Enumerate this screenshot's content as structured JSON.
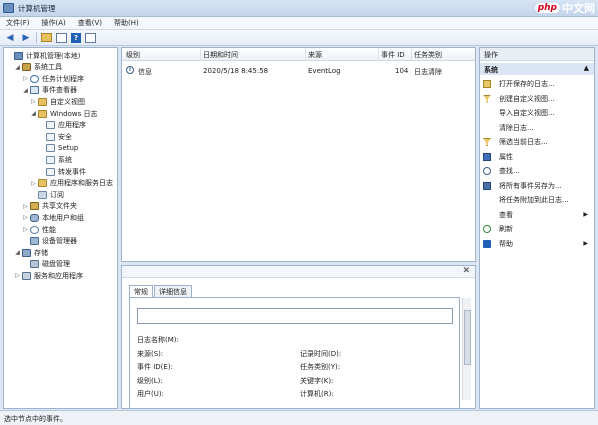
{
  "window": {
    "title": "计算机管理",
    "watermark_logo": "php",
    "watermark_text": "中文网"
  },
  "menu": [
    "文件(F)",
    "操作(A)",
    "查看(V)",
    "帮助(H)"
  ],
  "tree": [
    {
      "label": "计算机管理(本地)",
      "twisty": "",
      "indent": 0,
      "icon": "computer-icon"
    },
    {
      "label": "系统工具",
      "twisty": "◢",
      "indent": 1,
      "icon": "tools-icon"
    },
    {
      "label": "任务计划程序",
      "twisty": "▷",
      "indent": 2,
      "icon": "clock-icon"
    },
    {
      "label": "事件查看器",
      "twisty": "◢",
      "indent": 2,
      "icon": "event-viewer-icon"
    },
    {
      "label": "自定义视图",
      "twisty": "▷",
      "indent": 3,
      "icon": "folder-icon"
    },
    {
      "label": "Windows 日志",
      "twisty": "◢",
      "indent": 3,
      "icon": "folder-icon"
    },
    {
      "label": "应用程序",
      "twisty": "",
      "indent": 4,
      "icon": "log-icon"
    },
    {
      "label": "安全",
      "twisty": "",
      "indent": 4,
      "icon": "log-icon"
    },
    {
      "label": "Setup",
      "twisty": "",
      "indent": 4,
      "icon": "log-icon"
    },
    {
      "label": "系统",
      "twisty": "",
      "indent": 4,
      "icon": "log-icon"
    },
    {
      "label": "转发事件",
      "twisty": "",
      "indent": 4,
      "icon": "log-icon"
    },
    {
      "label": "应用程序和服务日志",
      "twisty": "▷",
      "indent": 3,
      "icon": "folder-icon"
    },
    {
      "label": "订阅",
      "twisty": "",
      "indent": 3,
      "icon": "subscription-icon"
    },
    {
      "label": "共享文件夹",
      "twisty": "▷",
      "indent": 2,
      "icon": "shared-folder-icon"
    },
    {
      "label": "本地用户和组",
      "twisty": "▷",
      "indent": 2,
      "icon": "users-icon"
    },
    {
      "label": "性能",
      "twisty": "▷",
      "indent": 2,
      "icon": "performance-icon"
    },
    {
      "label": "设备管理器",
      "twisty": "",
      "indent": 2,
      "icon": "device-manager-icon"
    },
    {
      "label": "存储",
      "twisty": "◢",
      "indent": 1,
      "icon": "storage-icon"
    },
    {
      "label": "磁盘管理",
      "twisty": "",
      "indent": 2,
      "icon": "disk-icon"
    },
    {
      "label": "服务和应用程序",
      "twisty": "▷",
      "indent": 1,
      "icon": "services-icon"
    }
  ],
  "events": {
    "columns": [
      "级别",
      "日期和时间",
      "来源",
      "事件 ID",
      "任务类别"
    ],
    "rows": [
      {
        "level": "信息",
        "datetime": "2020/5/18 8:45:58",
        "source": "EventLog",
        "id": "104",
        "category": "日志清除"
      }
    ]
  },
  "detail": {
    "tabs": [
      "常规",
      "详细信息"
    ],
    "fields_left": [
      "日志名称(M):",
      "来源(S):",
      "事件 ID(E):",
      "级别(L):",
      "用户(U):"
    ],
    "fields_right": [
      "记录时间(D):",
      "任务类别(Y):",
      "关键字(K):",
      "计算机(R):"
    ]
  },
  "actions": {
    "header": "操作",
    "section": "系统",
    "items": [
      {
        "label": "打开保存的日志...",
        "icon": "open-log-icon"
      },
      {
        "label": "创建自定义视图...",
        "icon": "filter-icon"
      },
      {
        "label": "导入自定义视图...",
        "icon": ""
      },
      {
        "label": "清除日志...",
        "icon": ""
      },
      {
        "label": "筛选当前日志...",
        "icon": "filter-icon"
      },
      {
        "label": "属性",
        "icon": "properties-icon"
      },
      {
        "label": "查找...",
        "icon": "find-icon"
      },
      {
        "label": "将所有事件另存为...",
        "icon": "save-icon"
      },
      {
        "label": "将任务附加到此日志...",
        "icon": ""
      },
      {
        "label": "查看",
        "icon": "",
        "submenu": true
      },
      {
        "label": "刷新",
        "icon": "refresh-icon"
      },
      {
        "label": "帮助",
        "icon": "help-icon",
        "submenu": true
      }
    ]
  },
  "status": {
    "text": "选中节点中的事件。"
  }
}
